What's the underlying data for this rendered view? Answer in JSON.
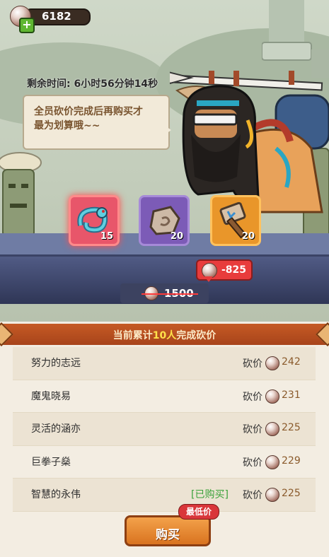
{
  "colors": {
    "accent": "#c55a24",
    "highlight": "#ffe24a",
    "bought": "#3aa23a",
    "discount": "#e83c3c"
  },
  "header": {
    "currency_value": "6182",
    "add_icon": "plus-icon",
    "currency_icon": "coin-icon"
  },
  "timer": {
    "text": "剩余时间: 6小时56分钟14秒"
  },
  "speech": {
    "line1": "全员砍价完成后再购买才",
    "line2": "最为划算哦~~"
  },
  "items": [
    {
      "icon": "dragon-icon",
      "count": "15"
    },
    {
      "icon": "stone-icon",
      "count": "20"
    },
    {
      "icon": "hammer-icon",
      "count": "20"
    }
  ],
  "price": {
    "discount": "-825",
    "original": "1500"
  },
  "banner": {
    "prefix": "当前累计",
    "count": "10人",
    "suffix": "完成砍价"
  },
  "bargain_list": [
    {
      "name": "努力的志远",
      "bought": "",
      "label": "砍价",
      "amount": "242"
    },
    {
      "name": "魔鬼晓易",
      "bought": "",
      "label": "砍价",
      "amount": "231"
    },
    {
      "name": "灵活的涵亦",
      "bought": "",
      "label": "砍价",
      "amount": "225"
    },
    {
      "name": "巨拳子燊",
      "bought": "",
      "label": "砍价",
      "amount": "229"
    },
    {
      "name": "智慧的永伟",
      "bought": "[已购买]",
      "label": "砍价",
      "amount": "225"
    }
  ],
  "buy": {
    "label": "购买",
    "badge": "最低价"
  }
}
